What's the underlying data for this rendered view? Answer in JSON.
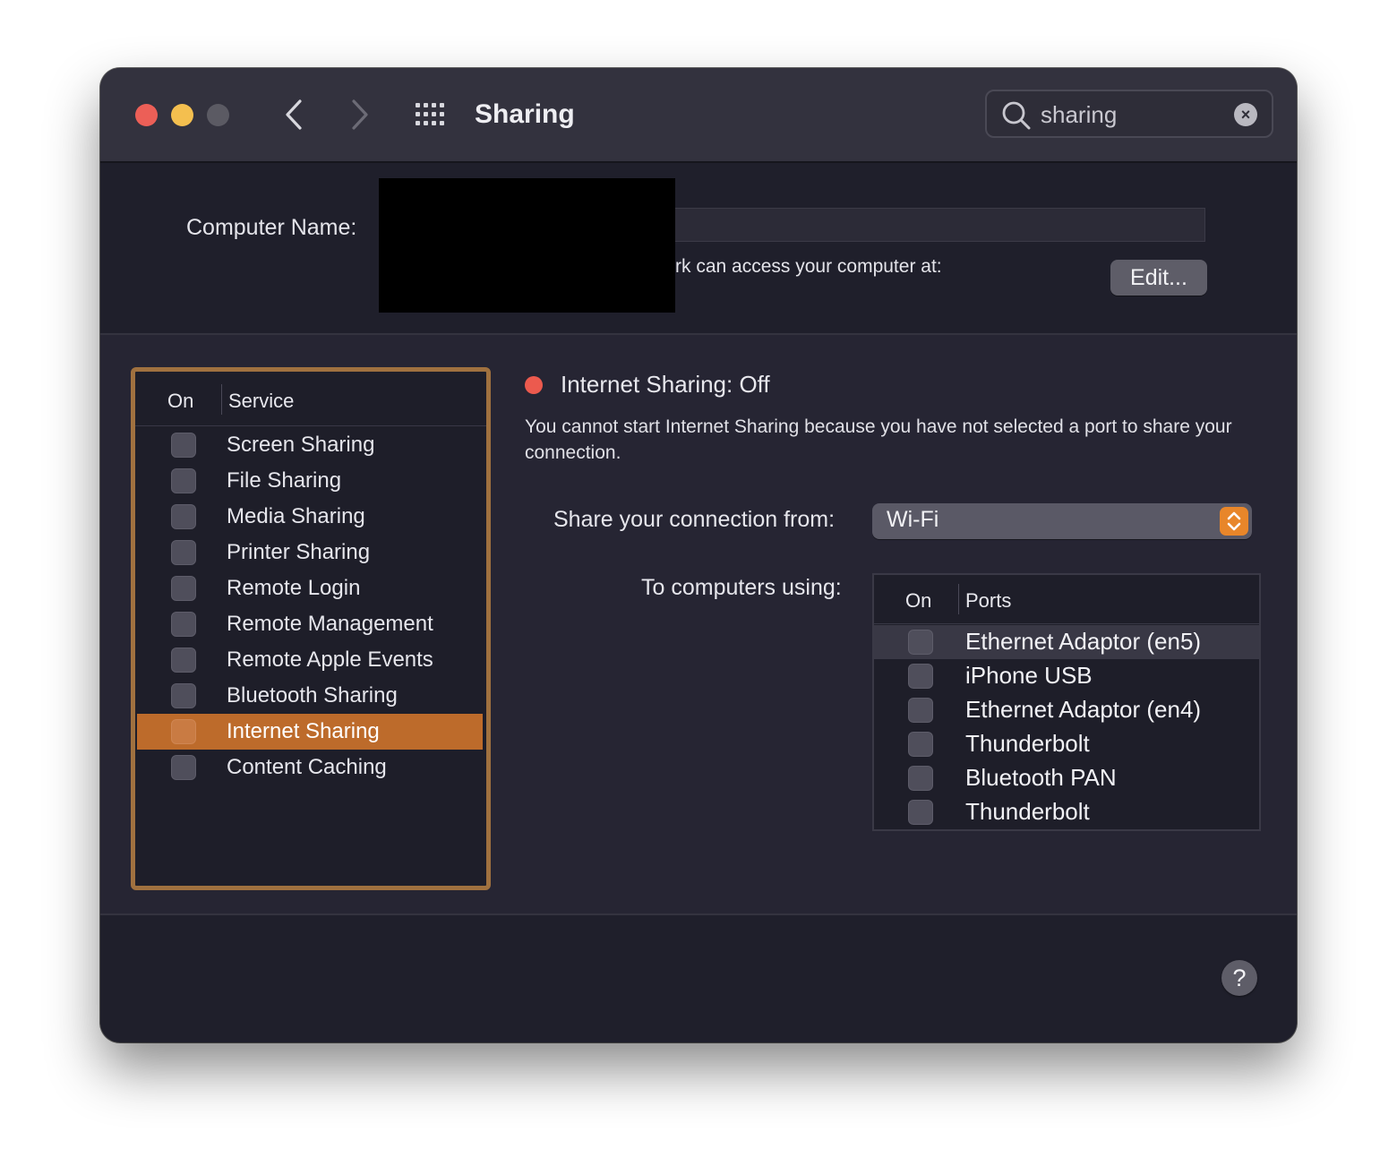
{
  "window": {
    "title": "Sharing",
    "search": {
      "value": "sharing",
      "clear_glyph": "×"
    }
  },
  "computer_name": {
    "label": "Computer Name:",
    "value": "",
    "access_text": "rk can access your computer at:",
    "edit_label": "Edit..."
  },
  "services": {
    "header_on": "On",
    "header_service": "Service",
    "items": [
      {
        "label": "Screen Sharing",
        "checked": false,
        "selected": false
      },
      {
        "label": "File Sharing",
        "checked": false,
        "selected": false
      },
      {
        "label": "Media Sharing",
        "checked": false,
        "selected": false
      },
      {
        "label": "Printer Sharing",
        "checked": false,
        "selected": false
      },
      {
        "label": "Remote Login",
        "checked": false,
        "selected": false
      },
      {
        "label": "Remote Management",
        "checked": false,
        "selected": false
      },
      {
        "label": "Remote Apple Events",
        "checked": false,
        "selected": false
      },
      {
        "label": "Bluetooth Sharing",
        "checked": false,
        "selected": false
      },
      {
        "label": "Internet Sharing",
        "checked": false,
        "selected": true
      },
      {
        "label": "Content Caching",
        "checked": false,
        "selected": false
      }
    ]
  },
  "detail": {
    "status_title": "Internet Sharing: Off",
    "status_color": "#ec5a4e",
    "description": "You cannot start Internet Sharing because you have not selected a port to share your connection.",
    "from_label": "Share your connection from:",
    "from_value": "Wi-Fi",
    "to_label": "To computers using:",
    "ports_header_on": "On",
    "ports_header_ports": "Ports",
    "ports": [
      {
        "label": "Ethernet Adaptor (en5)",
        "checked": false,
        "highlighted": true
      },
      {
        "label": "iPhone USB",
        "checked": false,
        "highlighted": false
      },
      {
        "label": "Ethernet Adaptor (en4)",
        "checked": false,
        "highlighted": false
      },
      {
        "label": "Thunderbolt",
        "checked": false,
        "highlighted": false
      },
      {
        "label": "Bluetooth PAN",
        "checked": false,
        "highlighted": false
      },
      {
        "label": "Thunderbolt",
        "checked": false,
        "highlighted": false
      }
    ]
  },
  "help_glyph": "?",
  "colors": {
    "accent": "#bd6b2b",
    "focus_ring": "#a0713f",
    "popup_arrow": "#e8862a",
    "close": "#ec5f57",
    "minimize": "#f4bf4f"
  }
}
